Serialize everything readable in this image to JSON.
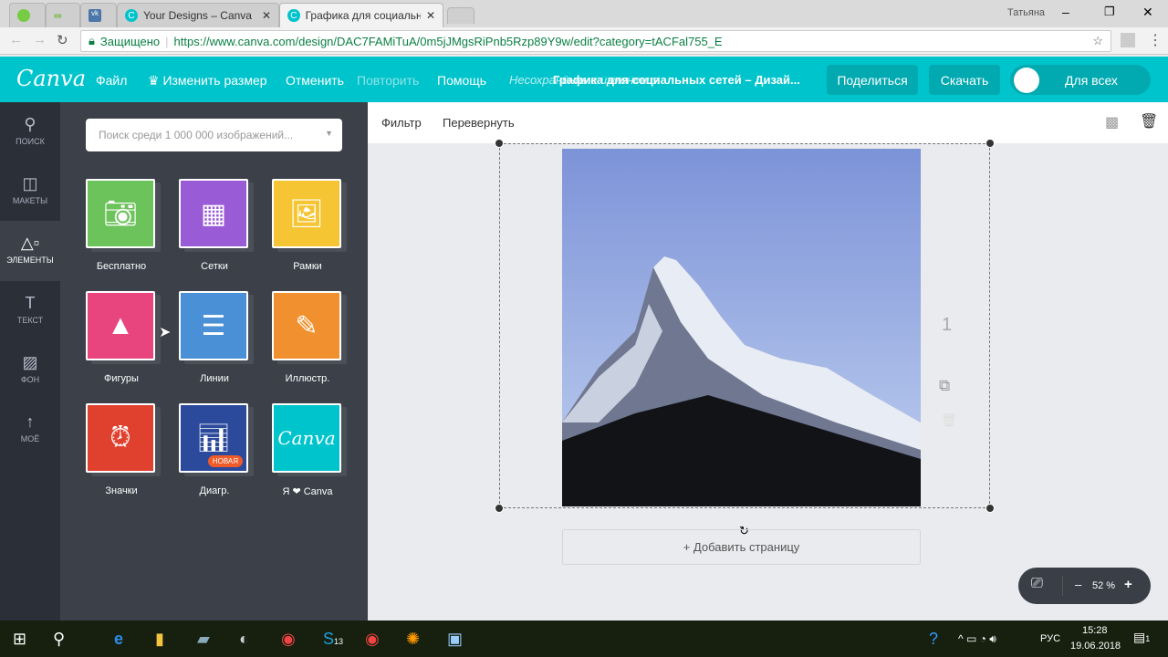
{
  "browser": {
    "tabs": [
      {
        "label": "Your Designs – Canva"
      },
      {
        "label": "Графика для социальны",
        "active": true
      }
    ],
    "secure_label": "Защищено",
    "url": "https://www.canva.com/design/DAC7FAMiTuA/0m5jJMgsRiPnb5Rzp89Y9w/edit?category=tACFal755_E",
    "user": "Татьяна"
  },
  "header": {
    "logo": "Canva",
    "menu": [
      "Файл",
      "Изменить размер",
      "Отменить",
      "Повторить",
      "Помощь"
    ],
    "status": "Несохранённые изменения",
    "title": "Графика для социальных сетей – Дизай...",
    "share": "Поделиться",
    "download": "Скачать",
    "visibility": "Для всех",
    "accent": "#00c4cc"
  },
  "rail": [
    {
      "label": "ПОИСК",
      "icon": "search-icon"
    },
    {
      "label": "МАКЕТЫ",
      "icon": "layout-icon"
    },
    {
      "label": "ЭЛЕМЕНТЫ",
      "icon": "shapes-icon",
      "active": true
    },
    {
      "label": "ТЕКСТ",
      "icon": "text-icon"
    },
    {
      "label": "ФОН",
      "icon": "background-icon"
    },
    {
      "label": "МОЁ",
      "icon": "upload-icon"
    }
  ],
  "panel": {
    "search_placeholder": "Поиск среди 1 000 000 изображений...",
    "items": [
      {
        "label": "Бесплатно",
        "color": "#6cc25b"
      },
      {
        "label": "Сетки",
        "color": "#9a5bd6"
      },
      {
        "label": "Рамки",
        "color": "#f5c533"
      },
      {
        "label": "Фигуры",
        "color": "#e8457f"
      },
      {
        "label": "Линии",
        "color": "#4a90d6"
      },
      {
        "label": "Иллюстр.",
        "color": "#f0902e"
      },
      {
        "label": "Значки",
        "color": "#e0402e"
      },
      {
        "label": "Диагр.",
        "color": "#2c4a9c",
        "badge": "НОВАЯ"
      },
      {
        "label": "Я ❤ Canva",
        "color": "#00c4cc",
        "art": "Canva"
      }
    ]
  },
  "toolbar": {
    "filter": "Фильтр",
    "flip": "Перевернуть"
  },
  "canvas": {
    "page_number": "1",
    "add_page": "+ Добавить страницу"
  },
  "zoom": {
    "value": "52 %",
    "minus": "–",
    "plus": "+"
  },
  "taskbar": {
    "lang": "РУС",
    "time": "15:28",
    "date": "19.06.2018",
    "skype_badge": "13",
    "notif_badge": "1"
  }
}
